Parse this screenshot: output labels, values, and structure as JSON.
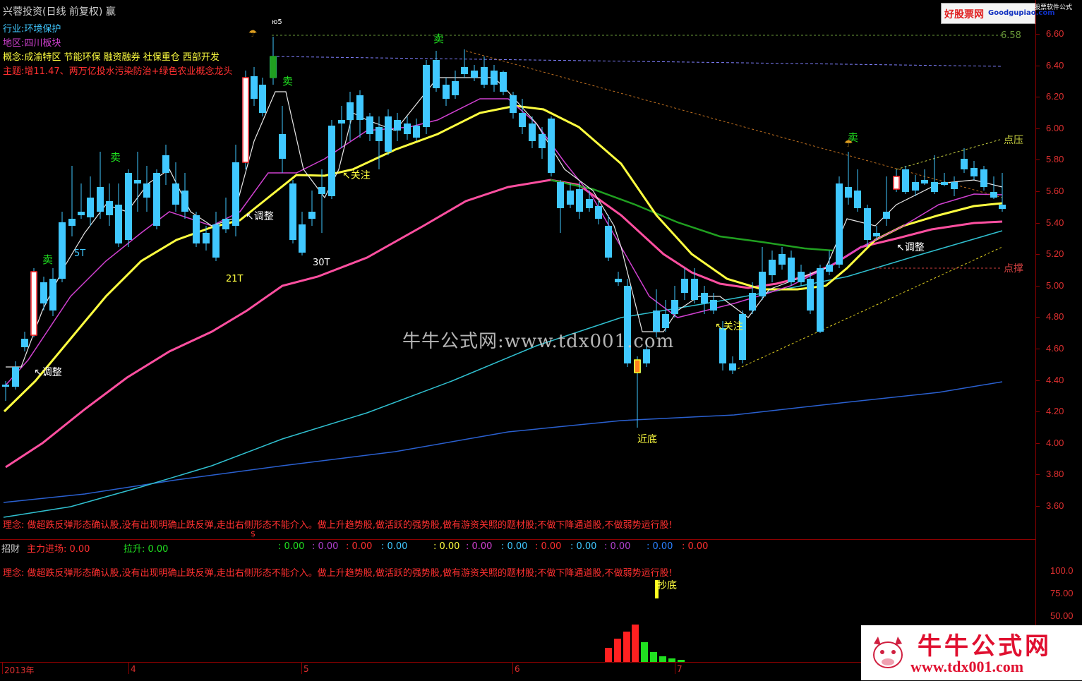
{
  "window": {
    "title": "兴蓉投资(日线 前复权) 赢"
  },
  "info": {
    "industry_label": "行业:",
    "industry_value": "环境保护",
    "region_label": "地区:",
    "region_value": "四川板块",
    "concept_label": "概念:",
    "concept_value": "成渝特区 节能环保 融资融券 社保重仓 西部开发",
    "theme_label": "主题:",
    "theme_value": "增11.47、两万亿投水污染防治+绿色农业概念龙头"
  },
  "price_axis": [
    "6.60",
    "6.40",
    "6.20",
    "6.00",
    "5.80",
    "5.60",
    "5.40",
    "5.20",
    "5.00",
    "4.80",
    "4.60",
    "4.40",
    "4.20",
    "4.00",
    "3.80",
    "3.60"
  ],
  "price_lines": {
    "high": "6.58",
    "pressure": "点压",
    "support": "点撑"
  },
  "annotations": {
    "sell": "卖",
    "adjust": "↖调整",
    "watch": "↖关注",
    "near_bottom": "近底",
    "t5": "5T",
    "t21": "21T",
    "t30": "30T",
    "top_tag": "ю5",
    "dollar": "$"
  },
  "philosophy": "理念: 做超跌反弹形态确认股,没有出现明确止跌反弹,走出右侧形态不能介入。做上升趋势股,做活跃的强势股,做有游资关照的题材股;不做下降通道股,不做弱势运行股!",
  "indicator": {
    "name": "招财",
    "main_inflow": "主力进场: 0.00",
    "pull_up": "拉升: 0.00",
    "values": [
      ": 0.00",
      ": 0.00",
      ": 0.00",
      ": 0.00",
      ": 0.00",
      ": 0.00",
      ": 0.00",
      ": 0.00",
      ": 0.00",
      ": 0.00",
      ": 0.00",
      ": 0.00"
    ],
    "axis": [
      "100.0",
      "75.00",
      "50.00"
    ],
    "bottom_label": "抄底"
  },
  "time_axis": [
    "2013年",
    "4",
    "5",
    "6",
    "7"
  ],
  "watermark": {
    "center": "牛牛公式网:www.tdx001.com",
    "logo_top_red": "好股票网",
    "logo_top_blue": "Goodgupiao.com",
    "logo_top_small": "股票软件公式",
    "logo_br_cn": "牛牛公式网",
    "logo_br_url": "www.tdx001.com"
  },
  "colors": {
    "up": "#ff2020",
    "down": "#40c8ff",
    "ma_yellow": "#ffff40",
    "ma_pink": "#ff4fa0",
    "ma_magenta": "#d040d0",
    "ma_green": "#20a020",
    "ma_cyan": "#30c0d0",
    "ma_blue": "#2a60d0"
  }
}
